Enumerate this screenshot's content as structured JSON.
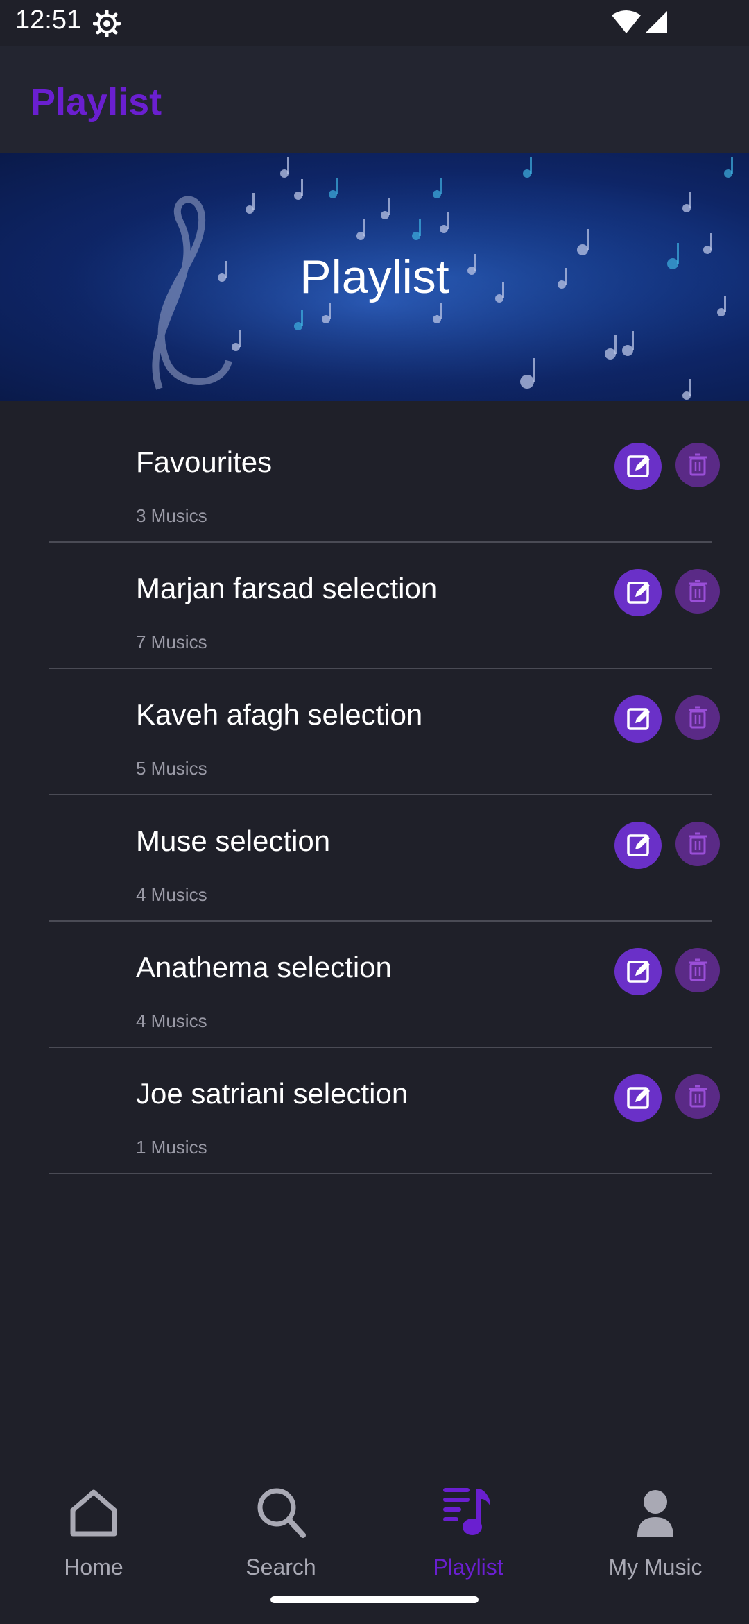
{
  "status": {
    "time": "12:51"
  },
  "app_bar": {
    "title": "Playlist"
  },
  "banner": {
    "title": "Playlist"
  },
  "playlists": [
    {
      "name": "Favourites",
      "count": "3 Musics"
    },
    {
      "name": "Marjan farsad selection",
      "count": "7 Musics"
    },
    {
      "name": "Kaveh afagh selection",
      "count": "5 Musics"
    },
    {
      "name": "Muse selection",
      "count": "4 Musics"
    },
    {
      "name": "Anathema selection",
      "count": "4 Musics"
    },
    {
      "name": "Joe satriani selection",
      "count": "1 Musics"
    }
  ],
  "nav": {
    "home": "Home",
    "search": "Search",
    "playlist": "Playlist",
    "my_music": "My Music",
    "active": "playlist"
  },
  "colors": {
    "accent": "#6a1fd0",
    "background": "#1f2029",
    "edit_button": "#6a30c8",
    "delete_button": "#5a2a86"
  },
  "icons": {
    "row_actions": [
      "edit-icon",
      "trash-icon"
    ],
    "nav": [
      "home-icon",
      "search-icon",
      "playlist-icon",
      "person-icon"
    ]
  }
}
